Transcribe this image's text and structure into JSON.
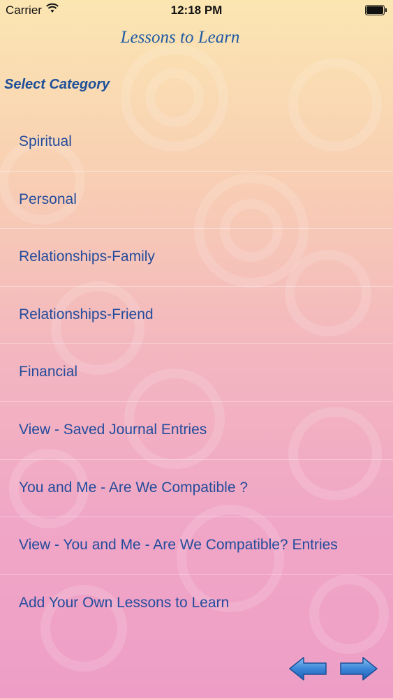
{
  "status_bar": {
    "carrier": "Carrier",
    "time": "12:18 PM"
  },
  "nav": {
    "title": "Lessons to Learn"
  },
  "section": {
    "header": "Select Category"
  },
  "menu": {
    "items": [
      {
        "label": "Spiritual"
      },
      {
        "label": "Personal"
      },
      {
        "label": "Relationships-Family"
      },
      {
        "label": "Relationships-Friend"
      },
      {
        "label": "Financial"
      },
      {
        "label": "View - Saved Journal Entries"
      },
      {
        "label": "You and Me - Are We Compatible ?"
      },
      {
        "label": "View - You and Me - Are We Compatible? Entries"
      },
      {
        "label": "Add Your Own Lessons to Learn"
      }
    ]
  },
  "icons": {
    "back": "arrow-left-icon",
    "forward": "arrow-right-icon",
    "wifi": "wifi-icon",
    "battery": "battery-icon"
  },
  "colors": {
    "text": "#244c9c",
    "title": "#1f5aa3",
    "arrow": "#3d86d8"
  }
}
